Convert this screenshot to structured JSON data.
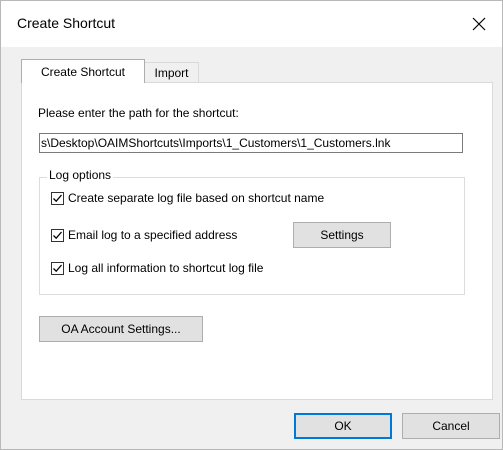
{
  "window": {
    "title": "Create Shortcut"
  },
  "tabs": [
    {
      "label": "Create Shortcut",
      "active": true
    },
    {
      "label": "Import",
      "active": false
    }
  ],
  "path": {
    "label": "Please enter the path for the shortcut:",
    "value": "s\\Desktop\\OAIMShortcuts\\Imports\\1_Customers\\1_Customers.lnk"
  },
  "log_options": {
    "legend": "Log options",
    "items": [
      {
        "label": "Create separate log file based on shortcut name",
        "checked": true
      },
      {
        "label": "Email log to a specified address",
        "checked": true
      },
      {
        "label": "Log all information to shortcut log file",
        "checked": true
      }
    ],
    "settings_label": "Settings"
  },
  "oa_button_label": "OA Account Settings...",
  "footer": {
    "ok_label": "OK",
    "cancel_label": "Cancel"
  },
  "colors": {
    "accent": "#0078d7"
  }
}
